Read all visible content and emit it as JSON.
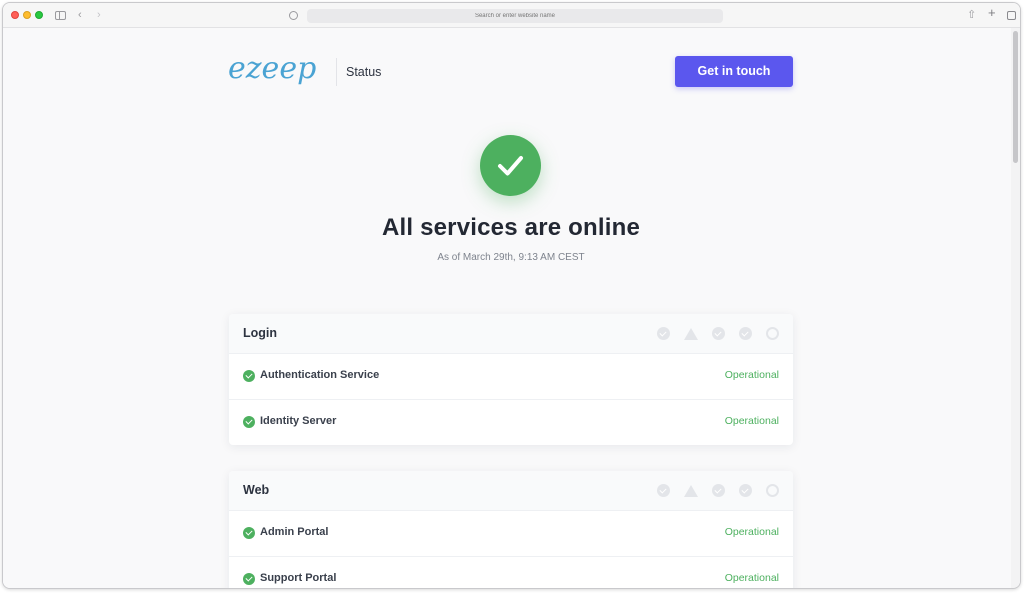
{
  "browser": {
    "url_placeholder": "Search or enter website name"
  },
  "header": {
    "logo_text": "ezeep",
    "page_label": "Status",
    "cta_label": "Get in touch"
  },
  "hero": {
    "title": "All services are online",
    "subtitle": "As of March 29th, 9:13 AM CEST"
  },
  "colors": {
    "accent": "#5b57ee",
    "operational": "#4db05f",
    "logo": "#4aa3d3"
  },
  "legend_icons": [
    "check-circle-icon",
    "warning-triangle-icon",
    "minus-circle-icon",
    "download-circle-icon",
    "empty-circle-icon"
  ],
  "groups": [
    {
      "name": "Login",
      "services": [
        {
          "name": "Authentication Service",
          "status": "Operational"
        },
        {
          "name": "Identity Server",
          "status": "Operational"
        }
      ]
    },
    {
      "name": "Web",
      "services": [
        {
          "name": "Admin Portal",
          "status": "Operational"
        },
        {
          "name": "Support Portal",
          "status": "Operational"
        }
      ]
    }
  ]
}
